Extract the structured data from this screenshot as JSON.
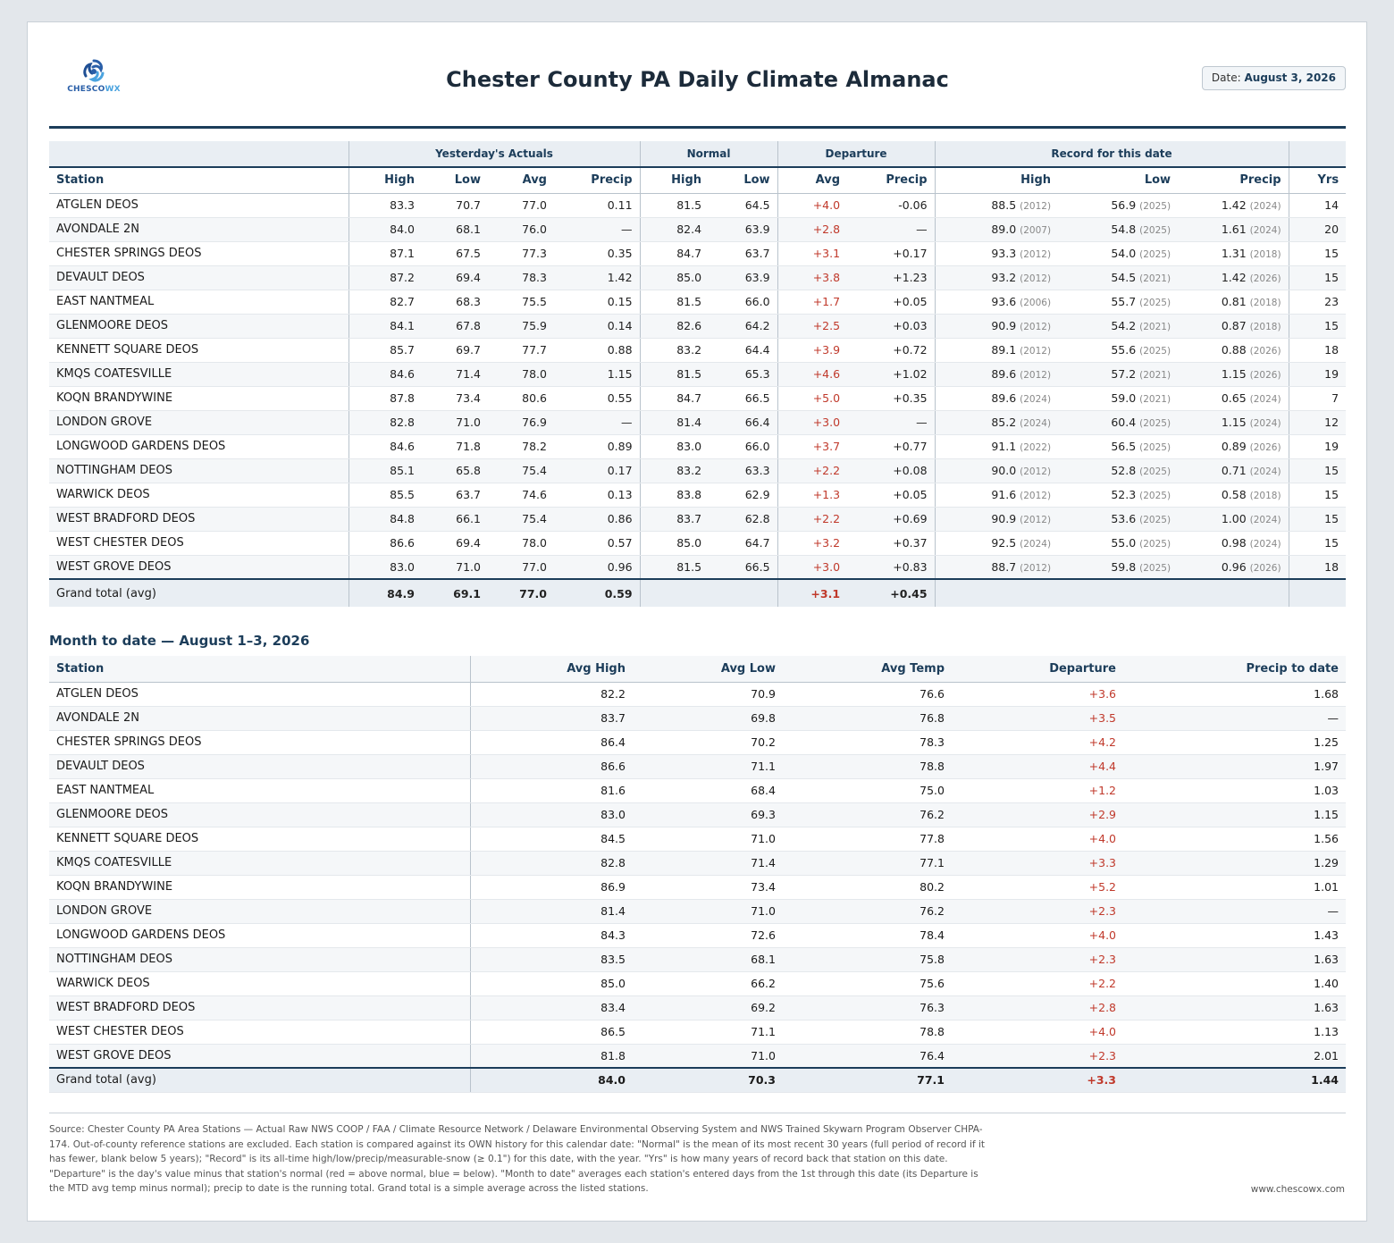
{
  "header": {
    "logo_text_a": "CHESCO",
    "logo_text_b": "WX",
    "title": "Chester County PA Daily Climate Almanac",
    "date_label": "Date:",
    "date_value": "August 3, 2026"
  },
  "daily": {
    "groups": [
      "Yesterday's Actuals",
      "Normal",
      "Departure",
      "Record for this date"
    ],
    "columns": [
      "Station",
      "High",
      "Low",
      "Avg",
      "Precip",
      "High",
      "Low",
      "Avg",
      "Precip",
      "High",
      "Low",
      "Precip",
      "Yrs"
    ],
    "rows": [
      {
        "station": "ATGLEN DEOS",
        "hi": "83.3",
        "lo": "70.7",
        "avg": "77.0",
        "pcp": "0.11",
        "nhi": "81.5",
        "nlo": "64.5",
        "davg": "+4.0",
        "dpcp": "-0.06",
        "rhi": "88.5",
        "rhiy": "(2012)",
        "rlo": "56.9",
        "rloy": "(2025)",
        "rpcp": "1.42",
        "rpcpy": "(2024)",
        "yrs": "14"
      },
      {
        "station": "AVONDALE 2N",
        "hi": "84.0",
        "lo": "68.1",
        "avg": "76.0",
        "pcp": "—",
        "nhi": "82.4",
        "nlo": "63.9",
        "davg": "+2.8",
        "dpcp": "—",
        "rhi": "89.0",
        "rhiy": "(2007)",
        "rlo": "54.8",
        "rloy": "(2025)",
        "rpcp": "1.61",
        "rpcpy": "(2024)",
        "yrs": "20"
      },
      {
        "station": "CHESTER SPRINGS DEOS",
        "hi": "87.1",
        "lo": "67.5",
        "avg": "77.3",
        "pcp": "0.35",
        "nhi": "84.7",
        "nlo": "63.7",
        "davg": "+3.1",
        "dpcp": "+0.17",
        "rhi": "93.3",
        "rhiy": "(2012)",
        "rlo": "54.0",
        "rloy": "(2025)",
        "rpcp": "1.31",
        "rpcpy": "(2018)",
        "yrs": "15"
      },
      {
        "station": "DEVAULT DEOS",
        "hi": "87.2",
        "lo": "69.4",
        "avg": "78.3",
        "pcp": "1.42",
        "nhi": "85.0",
        "nlo": "63.9",
        "davg": "+3.8",
        "dpcp": "+1.23",
        "rhi": "93.2",
        "rhiy": "(2012)",
        "rlo": "54.5",
        "rloy": "(2021)",
        "rpcp": "1.42",
        "rpcpy": "(2026)",
        "yrs": "15"
      },
      {
        "station": "EAST NANTMEAL",
        "hi": "82.7",
        "lo": "68.3",
        "avg": "75.5",
        "pcp": "0.15",
        "nhi": "81.5",
        "nlo": "66.0",
        "davg": "+1.7",
        "dpcp": "+0.05",
        "rhi": "93.6",
        "rhiy": "(2006)",
        "rlo": "55.7",
        "rloy": "(2025)",
        "rpcp": "0.81",
        "rpcpy": "(2018)",
        "yrs": "23"
      },
      {
        "station": "GLENMOORE DEOS",
        "hi": "84.1",
        "lo": "67.8",
        "avg": "75.9",
        "pcp": "0.14",
        "nhi": "82.6",
        "nlo": "64.2",
        "davg": "+2.5",
        "dpcp": "+0.03",
        "rhi": "90.9",
        "rhiy": "(2012)",
        "rlo": "54.2",
        "rloy": "(2021)",
        "rpcp": "0.87",
        "rpcpy": "(2018)",
        "yrs": "15"
      },
      {
        "station": "KENNETT SQUARE DEOS",
        "hi": "85.7",
        "lo": "69.7",
        "avg": "77.7",
        "pcp": "0.88",
        "nhi": "83.2",
        "nlo": "64.4",
        "davg": "+3.9",
        "dpcp": "+0.72",
        "rhi": "89.1",
        "rhiy": "(2012)",
        "rlo": "55.6",
        "rloy": "(2025)",
        "rpcp": "0.88",
        "rpcpy": "(2026)",
        "yrs": "18"
      },
      {
        "station": "KMQS COATESVILLE",
        "hi": "84.6",
        "lo": "71.4",
        "avg": "78.0",
        "pcp": "1.15",
        "nhi": "81.5",
        "nlo": "65.3",
        "davg": "+4.6",
        "dpcp": "+1.02",
        "rhi": "89.6",
        "rhiy": "(2012)",
        "rlo": "57.2",
        "rloy": "(2021)",
        "rpcp": "1.15",
        "rpcpy": "(2026)",
        "yrs": "19"
      },
      {
        "station": "KOQN BRANDYWINE",
        "hi": "87.8",
        "lo": "73.4",
        "avg": "80.6",
        "pcp": "0.55",
        "nhi": "84.7",
        "nlo": "66.5",
        "davg": "+5.0",
        "dpcp": "+0.35",
        "rhi": "89.6",
        "rhiy": "(2024)",
        "rlo": "59.0",
        "rloy": "(2021)",
        "rpcp": "0.65",
        "rpcpy": "(2024)",
        "yrs": "7"
      },
      {
        "station": "LONDON GROVE",
        "hi": "82.8",
        "lo": "71.0",
        "avg": "76.9",
        "pcp": "—",
        "nhi": "81.4",
        "nlo": "66.4",
        "davg": "+3.0",
        "dpcp": "—",
        "rhi": "85.2",
        "rhiy": "(2024)",
        "rlo": "60.4",
        "rloy": "(2025)",
        "rpcp": "1.15",
        "rpcpy": "(2024)",
        "yrs": "12"
      },
      {
        "station": "LONGWOOD GARDENS DEOS",
        "hi": "84.6",
        "lo": "71.8",
        "avg": "78.2",
        "pcp": "0.89",
        "nhi": "83.0",
        "nlo": "66.0",
        "davg": "+3.7",
        "dpcp": "+0.77",
        "rhi": "91.1",
        "rhiy": "(2022)",
        "rlo": "56.5",
        "rloy": "(2025)",
        "rpcp": "0.89",
        "rpcpy": "(2026)",
        "yrs": "19"
      },
      {
        "station": "NOTTINGHAM DEOS",
        "hi": "85.1",
        "lo": "65.8",
        "avg": "75.4",
        "pcp": "0.17",
        "nhi": "83.2",
        "nlo": "63.3",
        "davg": "+2.2",
        "dpcp": "+0.08",
        "rhi": "90.0",
        "rhiy": "(2012)",
        "rlo": "52.8",
        "rloy": "(2025)",
        "rpcp": "0.71",
        "rpcpy": "(2024)",
        "yrs": "15"
      },
      {
        "station": "WARWICK DEOS",
        "hi": "85.5",
        "lo": "63.7",
        "avg": "74.6",
        "pcp": "0.13",
        "nhi": "83.8",
        "nlo": "62.9",
        "davg": "+1.3",
        "dpcp": "+0.05",
        "rhi": "91.6",
        "rhiy": "(2012)",
        "rlo": "52.3",
        "rloy": "(2025)",
        "rpcp": "0.58",
        "rpcpy": "(2018)",
        "yrs": "15"
      },
      {
        "station": "WEST BRADFORD DEOS",
        "hi": "84.8",
        "lo": "66.1",
        "avg": "75.4",
        "pcp": "0.86",
        "nhi": "83.7",
        "nlo": "62.8",
        "davg": "+2.2",
        "dpcp": "+0.69",
        "rhi": "90.9",
        "rhiy": "(2012)",
        "rlo": "53.6",
        "rloy": "(2025)",
        "rpcp": "1.00",
        "rpcpy": "(2024)",
        "yrs": "15"
      },
      {
        "station": "WEST CHESTER DEOS",
        "hi": "86.6",
        "lo": "69.4",
        "avg": "78.0",
        "pcp": "0.57",
        "nhi": "85.0",
        "nlo": "64.7",
        "davg": "+3.2",
        "dpcp": "+0.37",
        "rhi": "92.5",
        "rhiy": "(2024)",
        "rlo": "55.0",
        "rloy": "(2025)",
        "rpcp": "0.98",
        "rpcpy": "(2024)",
        "yrs": "15"
      },
      {
        "station": "WEST GROVE DEOS",
        "hi": "83.0",
        "lo": "71.0",
        "avg": "77.0",
        "pcp": "0.96",
        "nhi": "81.5",
        "nlo": "66.5",
        "davg": "+3.0",
        "dpcp": "+0.83",
        "rhi": "88.7",
        "rhiy": "(2012)",
        "rlo": "59.8",
        "rloy": "(2025)",
        "rpcp": "0.96",
        "rpcpy": "(2026)",
        "yrs": "18"
      }
    ],
    "total": {
      "station": "Grand total (avg)",
      "hi": "84.9",
      "lo": "69.1",
      "avg": "77.0",
      "pcp": "0.59",
      "davg": "+3.1",
      "dpcp": "+0.45"
    }
  },
  "mtd": {
    "title": "Month to date — August 1–3, 2026",
    "columns": [
      "Station",
      "Avg High",
      "Avg Low",
      "Avg Temp",
      "Departure",
      "Precip to date"
    ],
    "rows": [
      {
        "station": "ATGLEN DEOS",
        "hi": "82.2",
        "lo": "70.9",
        "avg": "76.6",
        "dep": "+3.6",
        "pcp": "1.68"
      },
      {
        "station": "AVONDALE 2N",
        "hi": "83.7",
        "lo": "69.8",
        "avg": "76.8",
        "dep": "+3.5",
        "pcp": "—"
      },
      {
        "station": "CHESTER SPRINGS DEOS",
        "hi": "86.4",
        "lo": "70.2",
        "avg": "78.3",
        "dep": "+4.2",
        "pcp": "1.25"
      },
      {
        "station": "DEVAULT DEOS",
        "hi": "86.6",
        "lo": "71.1",
        "avg": "78.8",
        "dep": "+4.4",
        "pcp": "1.97"
      },
      {
        "station": "EAST NANTMEAL",
        "hi": "81.6",
        "lo": "68.4",
        "avg": "75.0",
        "dep": "+1.2",
        "pcp": "1.03"
      },
      {
        "station": "GLENMOORE DEOS",
        "hi": "83.0",
        "lo": "69.3",
        "avg": "76.2",
        "dep": "+2.9",
        "pcp": "1.15"
      },
      {
        "station": "KENNETT SQUARE DEOS",
        "hi": "84.5",
        "lo": "71.0",
        "avg": "77.8",
        "dep": "+4.0",
        "pcp": "1.56"
      },
      {
        "station": "KMQS COATESVILLE",
        "hi": "82.8",
        "lo": "71.4",
        "avg": "77.1",
        "dep": "+3.3",
        "pcp": "1.29"
      },
      {
        "station": "KOQN BRANDYWINE",
        "hi": "86.9",
        "lo": "73.4",
        "avg": "80.2",
        "dep": "+5.2",
        "pcp": "1.01"
      },
      {
        "station": "LONDON GROVE",
        "hi": "81.4",
        "lo": "71.0",
        "avg": "76.2",
        "dep": "+2.3",
        "pcp": "—"
      },
      {
        "station": "LONGWOOD GARDENS DEOS",
        "hi": "84.3",
        "lo": "72.6",
        "avg": "78.4",
        "dep": "+4.0",
        "pcp": "1.43"
      },
      {
        "station": "NOTTINGHAM DEOS",
        "hi": "83.5",
        "lo": "68.1",
        "avg": "75.8",
        "dep": "+2.3",
        "pcp": "1.63"
      },
      {
        "station": "WARWICK DEOS",
        "hi": "85.0",
        "lo": "66.2",
        "avg": "75.6",
        "dep": "+2.2",
        "pcp": "1.40"
      },
      {
        "station": "WEST BRADFORD DEOS",
        "hi": "83.4",
        "lo": "69.2",
        "avg": "76.3",
        "dep": "+2.8",
        "pcp": "1.63"
      },
      {
        "station": "WEST CHESTER DEOS",
        "hi": "86.5",
        "lo": "71.1",
        "avg": "78.8",
        "dep": "+4.0",
        "pcp": "1.13"
      },
      {
        "station": "WEST GROVE DEOS",
        "hi": "81.8",
        "lo": "71.0",
        "avg": "76.4",
        "dep": "+2.3",
        "pcp": "2.01"
      }
    ],
    "total": {
      "station": "Grand total (avg)",
      "hi": "84.0",
      "lo": "70.3",
      "avg": "77.1",
      "dep": "+3.3",
      "pcp": "1.44"
    }
  },
  "footer": {
    "note": "Source: Chester County PA Area Stations — Actual Raw NWS COOP / FAA / Climate Resource Network / Delaware Environmental Observing System and NWS Trained Skywarn Program Observer CHPA-174. Out-of-county reference stations are excluded. Each station is compared against its OWN history for this calendar date: \"Normal\" is the mean of its most recent 30 years (full period of record if it has fewer, blank below 5 years); \"Record\" is its all-time high/low/precip/measurable-snow (≥ 0.1\") for this date, with the year. \"Yrs\" is how many years of record back that station on this date. \"Departure\" is the day's value minus that station's normal (red = above normal, blue = below). \"Month to date\" averages each station's entered days from the 1st through this date (its Departure is the MTD avg temp minus normal); precip to date is the running total. Grand total is a simple average across the listed stations.",
    "site": "www.chescowx.com"
  },
  "colors": {
    "warm": "#c0392b",
    "cool": "#2a62b8",
    "accent": "#1c3d5a"
  }
}
